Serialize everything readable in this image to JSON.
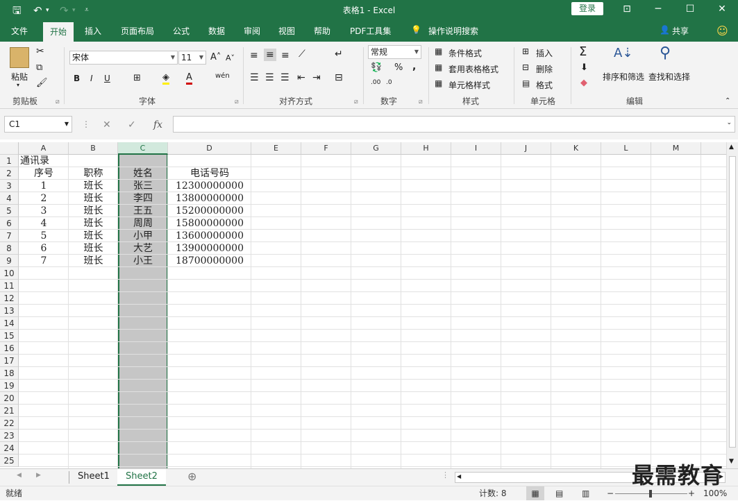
{
  "window": {
    "title": "表格1  -  Excel",
    "login_label": "登录"
  },
  "tabs": [
    "文件",
    "开始",
    "插入",
    "页面布局",
    "公式",
    "数据",
    "审阅",
    "视图",
    "帮助",
    "PDF工具集",
    "操作说明搜索"
  ],
  "share_label": "共享",
  "ribbon": {
    "clipboard": {
      "paste_label": "粘贴",
      "group_label": "剪贴板"
    },
    "font": {
      "font_name": "宋体",
      "font_size": "11",
      "bold": "B",
      "italic": "I",
      "underline": "U",
      "group_label": "字体"
    },
    "alignment": {
      "group_label": "对齐方式"
    },
    "number": {
      "format": "常规",
      "percent": "%",
      "comma": ",",
      "group_label": "数字"
    },
    "styles": {
      "conditional": "条件格式",
      "table_format": "套用表格格式",
      "cell_styles": "单元格样式",
      "group_label": "样式"
    },
    "cells": {
      "insert": "插入",
      "delete": "删除",
      "format": "格式",
      "group_label": "单元格"
    },
    "editing": {
      "sort_filter": "排序和筛选",
      "find_select": "查找和选择",
      "group_label": "编辑"
    }
  },
  "formula_bar": {
    "name_box": "C1",
    "fx": "fx",
    "formula": ""
  },
  "columns": [
    "A",
    "B",
    "C",
    "D",
    "E",
    "F",
    "G",
    "H",
    "I",
    "J",
    "K",
    "L",
    "M"
  ],
  "rows": [
    "1",
    "2",
    "3",
    "4",
    "5",
    "6",
    "7",
    "8",
    "9",
    "10",
    "11",
    "12",
    "13",
    "14",
    "15",
    "16",
    "17",
    "18",
    "19",
    "20",
    "21",
    "22",
    "23",
    "24",
    "25"
  ],
  "sheet": {
    "title": "通讯录",
    "headers": [
      "序号",
      "职称",
      "姓名",
      "电话号码"
    ],
    "data": [
      [
        "1",
        "班长",
        "张三",
        "12300000000"
      ],
      [
        "2",
        "班长",
        "李四",
        "13800000000"
      ],
      [
        "3",
        "班长",
        "王五",
        "15200000000"
      ],
      [
        "4",
        "班长",
        "周周",
        "15800000000"
      ],
      [
        "5",
        "班长",
        "小甲",
        "13600000000"
      ],
      [
        "6",
        "班长",
        "大艺",
        "13900000000"
      ],
      [
        "7",
        "班长",
        "小王",
        "18700000000"
      ]
    ]
  },
  "sheet_tabs": [
    "Sheet1",
    "Sheet2"
  ],
  "status": {
    "ready": "就绪",
    "count": "计数: 8",
    "zoom": "100%"
  },
  "watermark": "最需教育"
}
